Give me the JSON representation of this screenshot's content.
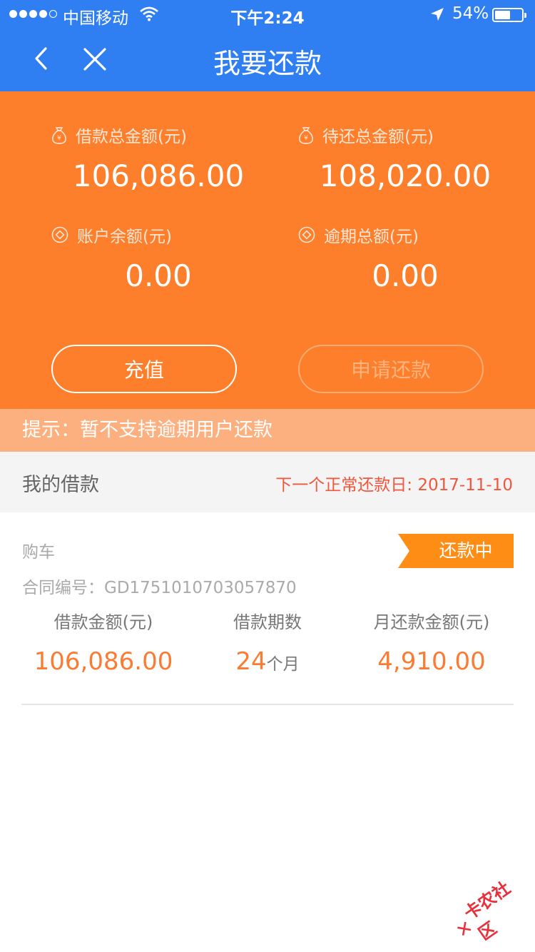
{
  "status_bar": {
    "carrier": "中国移动",
    "time": "下午2:24",
    "battery_pct": "54%",
    "signal_bars": 4,
    "signal_total": 5,
    "battery_level": 0.54
  },
  "nav": {
    "title": "我要还款",
    "back_icon": "chevron-left-icon",
    "close_icon": "close-icon"
  },
  "summary": {
    "total_loan": {
      "label": "借款总金额(元)",
      "value": "106,086.00"
    },
    "total_due": {
      "label": "待还总金额(元)",
      "value": "108,020.00"
    },
    "balance": {
      "label": "账户余额(元)",
      "value": "0.00"
    },
    "overdue": {
      "label": "逾期总额(元)",
      "value": "0.00"
    },
    "recharge_label": "充值",
    "apply_label": "申请还款"
  },
  "notice": "提示：暂不支持逾期用户还款",
  "loans": {
    "title": "我的借款",
    "next_due": "下一个正常还款日: 2017-11-10",
    "card": {
      "purpose": "购车",
      "status": "还款中",
      "contract": "合同编号：GD1751010703057870",
      "amount_label": "借款金额(元)",
      "amount": "106,086.00",
      "term_label": "借款期数",
      "term_value": "24",
      "term_unit": "个月",
      "monthly_label": "月还款金额(元)",
      "monthly": "4,910.00"
    }
  },
  "watermark": "卡农社区",
  "colors": {
    "nav_blue": "#2f7ff3",
    "summary_orange": "#fe7f2b",
    "notice_orange": "#fdb07f",
    "badge_orange": "#fd8d14",
    "accent_red": "#f0563c",
    "value_orange": "#fb7b32"
  }
}
